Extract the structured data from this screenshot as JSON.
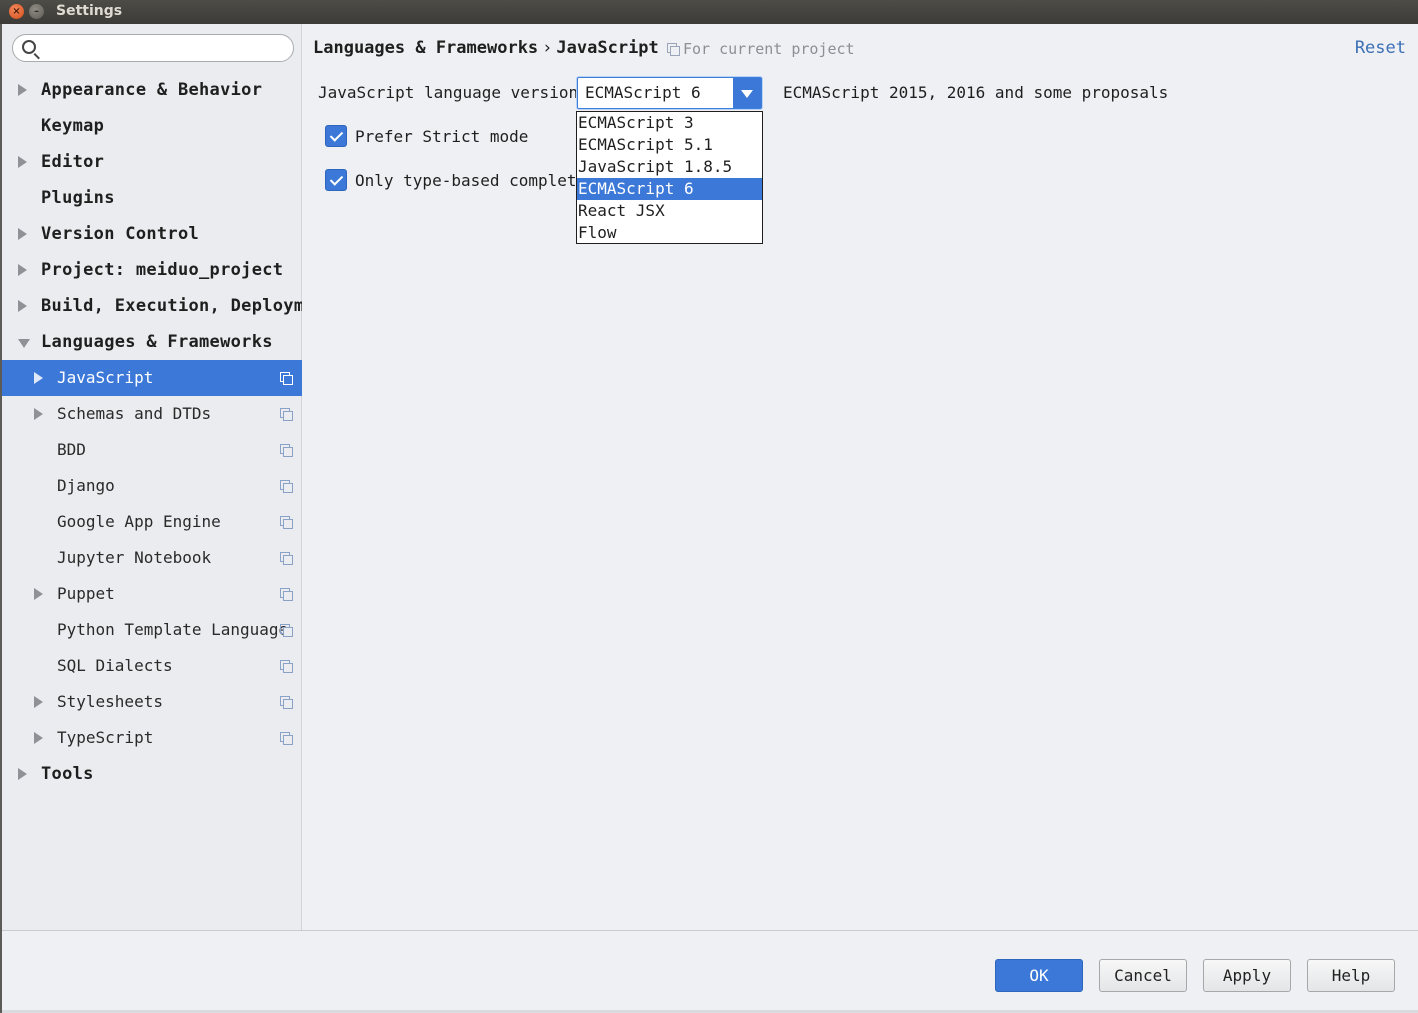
{
  "window": {
    "title": "Settings"
  },
  "search": {
    "placeholder": ""
  },
  "sidebar": {
    "items": [
      {
        "label": "Appearance & Behavior",
        "level": 0,
        "arrow": "right"
      },
      {
        "label": "Keymap",
        "level": 0,
        "arrow": "none"
      },
      {
        "label": "Editor",
        "level": 0,
        "arrow": "right"
      },
      {
        "label": "Plugins",
        "level": 0,
        "arrow": "none"
      },
      {
        "label": "Version Control",
        "level": 0,
        "arrow": "right"
      },
      {
        "label": "Project: meiduo_project",
        "level": 0,
        "arrow": "right"
      },
      {
        "label": "Build, Execution, Deploym",
        "level": 0,
        "arrow": "right"
      },
      {
        "label": "Languages & Frameworks",
        "level": 0,
        "arrow": "down"
      },
      {
        "label": "JavaScript",
        "level": 1,
        "arrow": "right",
        "selected": true,
        "project_icon": true
      },
      {
        "label": "Schemas and DTDs",
        "level": 1,
        "arrow": "right",
        "project_icon": true
      },
      {
        "label": "BDD",
        "level": 1,
        "arrow": "none",
        "project_icon": true
      },
      {
        "label": "Django",
        "level": 1,
        "arrow": "none",
        "project_icon": true
      },
      {
        "label": "Google App Engine",
        "level": 1,
        "arrow": "none",
        "project_icon": true
      },
      {
        "label": "Jupyter Notebook",
        "level": 1,
        "arrow": "none",
        "project_icon": true
      },
      {
        "label": "Puppet",
        "level": 1,
        "arrow": "right",
        "project_icon": true
      },
      {
        "label": "Python Template Language",
        "level": 1,
        "arrow": "none",
        "project_icon": true
      },
      {
        "label": "SQL Dialects",
        "level": 1,
        "arrow": "none",
        "project_icon": true
      },
      {
        "label": "Stylesheets",
        "level": 1,
        "arrow": "right",
        "project_icon": true
      },
      {
        "label": "TypeScript",
        "level": 1,
        "arrow": "right",
        "project_icon": true
      },
      {
        "label": "Tools",
        "level": 0,
        "arrow": "right"
      }
    ]
  },
  "header": {
    "breadcrumb_parent": "Languages & Frameworks",
    "breadcrumb_sep": "›",
    "breadcrumb_current": "JavaScript",
    "scope": "For current project",
    "reset": "Reset"
  },
  "main": {
    "language_label": "JavaScript language version",
    "language_value": "ECMAScript 6",
    "language_description": "ECMAScript 2015, 2016 and some proposals",
    "prefer_strict_label": "Prefer Strict mode",
    "prefer_strict_checked": true,
    "only_type_based_label": "Only type-based completic",
    "only_type_based_checked": true,
    "dropdown_options": [
      "ECMAScript 3",
      "ECMAScript 5.1",
      "JavaScript 1.8.5",
      "ECMAScript 6",
      "React JSX",
      "Flow"
    ],
    "dropdown_selected_index": 3
  },
  "footer": {
    "ok": "OK",
    "cancel": "Cancel",
    "apply": "Apply",
    "help": "Help"
  },
  "colors": {
    "accent": "#3b78d8",
    "link": "#3b6fb6",
    "sidebar_bg": "#eaecef",
    "panel_bg": "#eef0f3"
  }
}
